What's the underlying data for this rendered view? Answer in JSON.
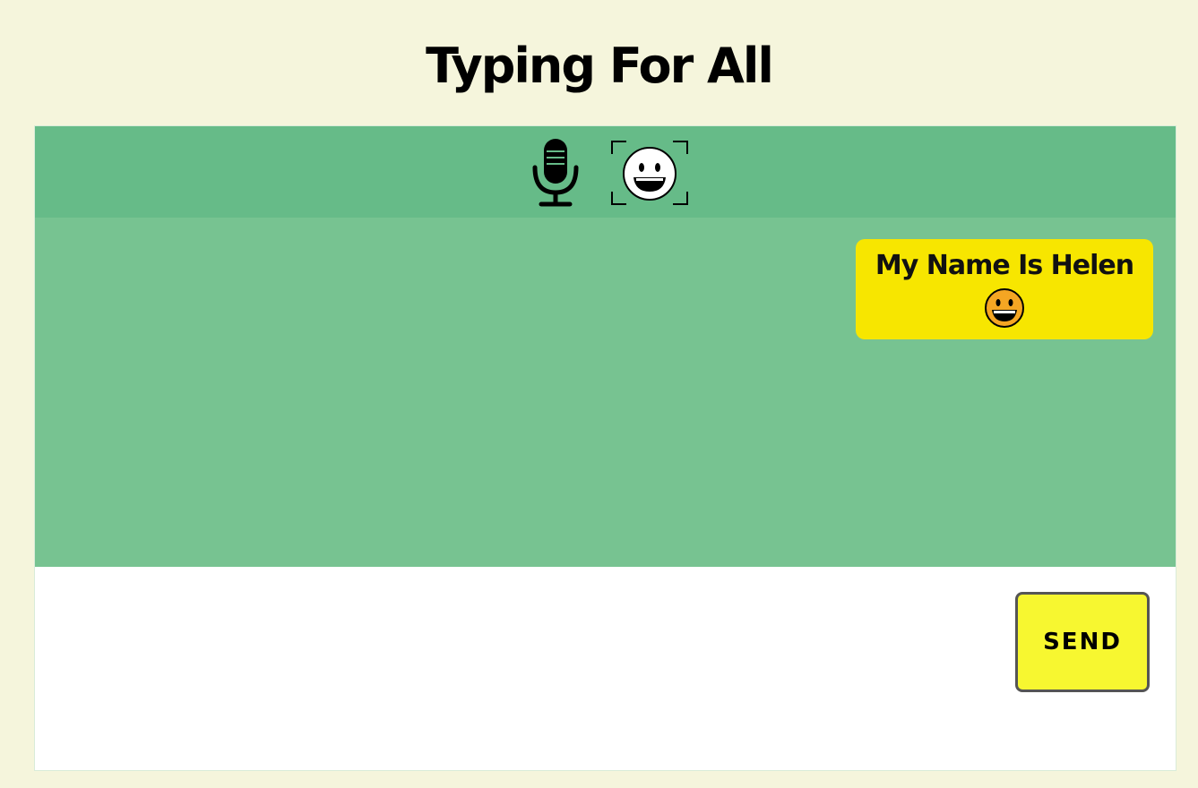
{
  "header": {
    "title": "Typing For All"
  },
  "toolbar": {
    "mic_icon": "microphone-icon",
    "emoji_icon": "face-scan-emoji-icon",
    "color": "#66bb88"
  },
  "chat": {
    "background": "#77c391",
    "messages": [
      {
        "text": "My Name Is Helen",
        "emoji_icon": "grinning-face-icon",
        "bubble_color": "#f7e600"
      }
    ]
  },
  "composer": {
    "input_value": "",
    "send_label": "SEND",
    "send_color": "#f7f730"
  }
}
